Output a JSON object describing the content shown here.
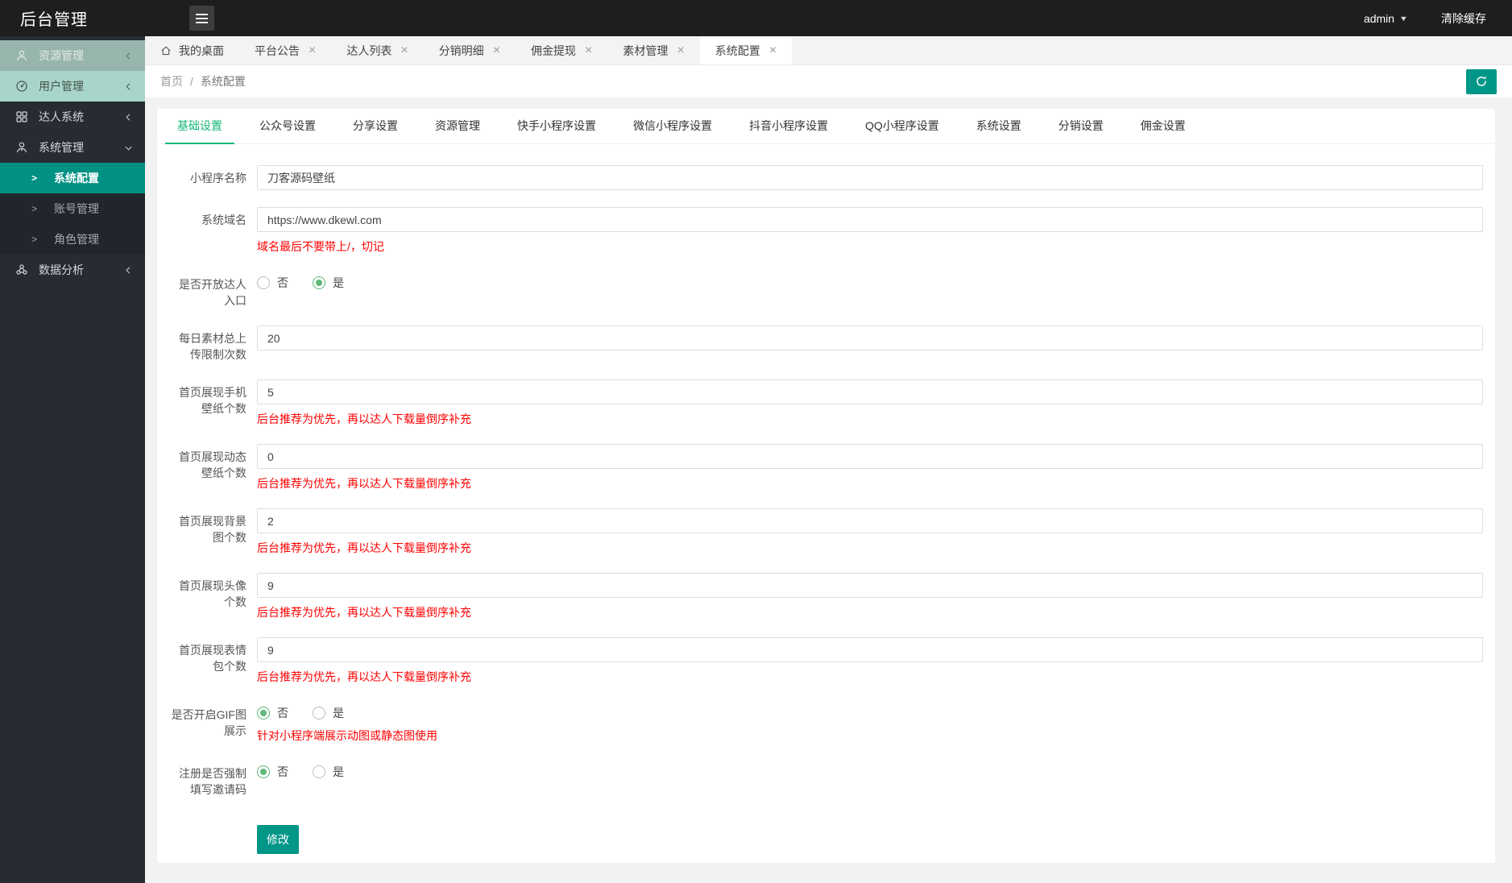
{
  "header": {
    "title": "后台管理",
    "user": "admin",
    "clear_cache": "清除缓存"
  },
  "colors": {
    "accent": "#009688",
    "sidebar_active": "#009183",
    "tab_active": "#16b777",
    "radio_green": "#5FB878",
    "hint_red": "#ff0000"
  },
  "sidebar": {
    "items": [
      {
        "id": "resource-manage",
        "label": "资源管理",
        "icon": "user-icon",
        "variant": "v1",
        "chevron": "left"
      },
      {
        "id": "user-manage",
        "label": "用户管理",
        "icon": "gauge-icon",
        "variant": "v2",
        "chevron": "left"
      },
      {
        "id": "talent-system",
        "label": "达人系统",
        "icon": "grid-icon",
        "chevron": "left"
      },
      {
        "id": "system-manage",
        "label": "系统管理",
        "icon": "admin-user-icon",
        "chevron": "down",
        "children": [
          {
            "id": "system-config",
            "label": "系统配置",
            "active": true
          },
          {
            "id": "account-manage",
            "label": "账号管理"
          },
          {
            "id": "role-manage",
            "label": "角色管理"
          }
        ]
      },
      {
        "id": "data-analysis",
        "label": "数据分析",
        "icon": "cloud-icon",
        "chevron": "left"
      }
    ]
  },
  "tabbar": {
    "tabs": [
      {
        "id": "my-desktop",
        "label": "我的桌面",
        "icon": "home-icon",
        "closable": false
      },
      {
        "id": "platform-announcement",
        "label": "平台公告",
        "closable": true
      },
      {
        "id": "talent-list",
        "label": "达人列表",
        "closable": true
      },
      {
        "id": "distribution-detail",
        "label": "分销明细",
        "closable": true
      },
      {
        "id": "commission-withdraw",
        "label": "佣金提现",
        "closable": true
      },
      {
        "id": "material-manage",
        "label": "素材管理",
        "closable": true
      },
      {
        "id": "system-config",
        "label": "系统配置",
        "closable": true,
        "active": true
      }
    ]
  },
  "breadcrumb": {
    "home": "首页",
    "separator": "/",
    "current": "系统配置"
  },
  "settings_tabs": [
    {
      "id": "basic",
      "label": "基础设置",
      "active": true
    },
    {
      "id": "official-account",
      "label": "公众号设置"
    },
    {
      "id": "share",
      "label": "分享设置"
    },
    {
      "id": "resource",
      "label": "资源管理"
    },
    {
      "id": "kuaishou-mini",
      "label": "快手小程序设置"
    },
    {
      "id": "wechat-mini",
      "label": "微信小程序设置"
    },
    {
      "id": "douyin-mini",
      "label": "抖音小程序设置"
    },
    {
      "id": "qq-mini",
      "label": "QQ小程序设置"
    },
    {
      "id": "system",
      "label": "系统设置"
    },
    {
      "id": "distribution",
      "label": "分销设置"
    },
    {
      "id": "commission",
      "label": "佣金设置"
    }
  ],
  "form": {
    "fields": [
      {
        "id": "mini-program-name",
        "type": "input",
        "label": "小程序名称",
        "value": "刀客源码壁纸"
      },
      {
        "id": "system-domain",
        "type": "input",
        "label": "系统域名",
        "value": "https://www.dkewl.com",
        "hint": "域名最后不要带上/，切记"
      },
      {
        "id": "open-talent-entry",
        "type": "radio",
        "label": "是否开放达人入口",
        "options": [
          "否",
          "是"
        ],
        "selected": 1
      },
      {
        "id": "daily-upload-limit",
        "type": "input",
        "label": "每日素材总上传限制次数",
        "value": "20"
      },
      {
        "id": "home-phone-wallpaper-count",
        "type": "input",
        "label": "首页展现手机壁纸个数",
        "value": "5",
        "hint": "后台推荐为优先，再以达人下载量倒序补充"
      },
      {
        "id": "home-dynamic-wallpaper-count",
        "type": "input",
        "label": "首页展现动态壁纸个数",
        "value": "0",
        "hint": "后台推荐为优先，再以达人下载量倒序补充"
      },
      {
        "id": "home-background-count",
        "type": "input",
        "label": "首页展现背景图个数",
        "value": "2",
        "hint": "后台推荐为优先，再以达人下载量倒序补充"
      },
      {
        "id": "home-avatar-count",
        "type": "input",
        "label": "首页展现头像个数",
        "value": "9",
        "hint": "后台推荐为优先，再以达人下载量倒序补充"
      },
      {
        "id": "home-emoji-count",
        "type": "input",
        "label": "首页展现表情包个数",
        "value": "9",
        "hint": "后台推荐为优先，再以达人下载量倒序补充"
      },
      {
        "id": "gif-display",
        "type": "radio",
        "label": "是否开启GIF图展示",
        "options": [
          "否",
          "是"
        ],
        "selected": 0,
        "hint": "针对小程序端展示动图或静态图使用"
      },
      {
        "id": "register-invite-code",
        "type": "radio",
        "label": "注册是否强制填写邀请码",
        "options": [
          "否",
          "是"
        ],
        "selected": 0
      }
    ],
    "submit_label": "修改"
  }
}
